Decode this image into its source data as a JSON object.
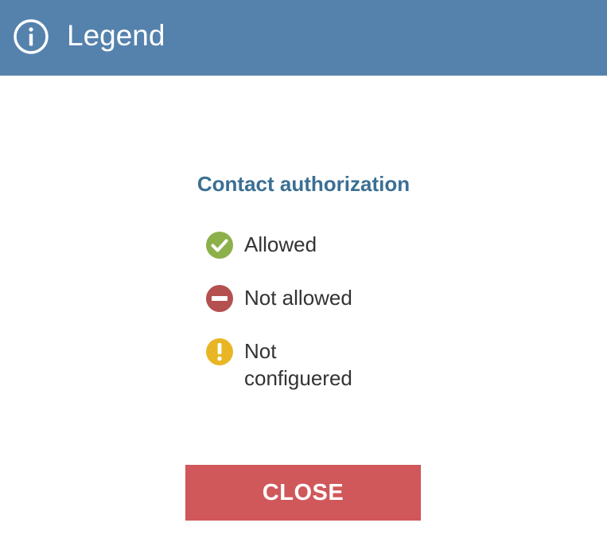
{
  "dialog": {
    "title": "Legend",
    "title_icon": "info-icon",
    "header_color": "#5582ad"
  },
  "section": {
    "heading": "Contact authorization",
    "heading_color": "#3b6f93"
  },
  "legend_items": [
    {
      "label": "Allowed",
      "icon": "check-circle-icon",
      "color": "#8cb04a"
    },
    {
      "label": "Not allowed",
      "icon": "minus-circle-icon",
      "color": "#b4504f"
    },
    {
      "label": "Not configuered",
      "icon": "exclamation-circle-icon",
      "color": "#e8b625"
    }
  ],
  "footer": {
    "close_label": "CLOSE",
    "close_color": "#d0575a"
  }
}
